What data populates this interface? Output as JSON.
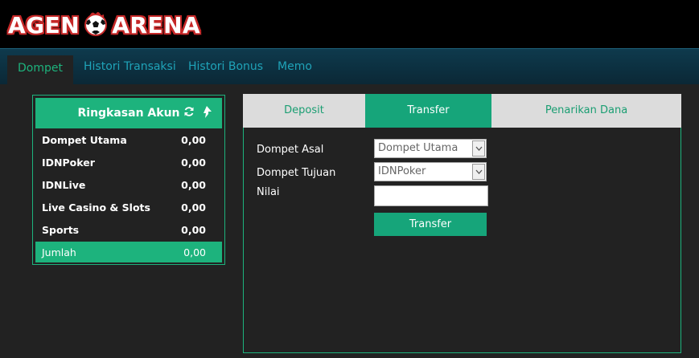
{
  "brand": {
    "left": "AGEN",
    "right": "ARENA"
  },
  "nav": {
    "tabs": [
      "Dompet",
      "Histori Transaksi",
      "Histori Bonus",
      "Memo"
    ],
    "active": "Dompet"
  },
  "summary": {
    "title": "Ringkasan Akun",
    "rows": [
      {
        "label": "Dompet Utama",
        "value": "0,00"
      },
      {
        "label": "IDNPoker",
        "value": "0,00"
      },
      {
        "label": "IDNLive",
        "value": "0,00"
      },
      {
        "label": "Live Casino & Slots",
        "value": "0,00"
      },
      {
        "label": "Sports",
        "value": "0,00"
      }
    ],
    "total": {
      "label": "Jumlah",
      "value": "0,00"
    }
  },
  "wallet_tabs": [
    "Deposit",
    "Transfer",
    "Penarikan Dana"
  ],
  "active_wallet_tab": "Transfer",
  "form": {
    "from_label": "Dompet Asal",
    "from_value": "Dompet Utama",
    "to_label": "Dompet Tujuan",
    "to_value": "IDNPoker",
    "amount_label": "Nilai",
    "amount_value": "",
    "submit_label": "Transfer"
  },
  "colors": {
    "accent": "#1db37d",
    "nav_text": "#1fa3b8",
    "brand_red": "#c62828"
  }
}
